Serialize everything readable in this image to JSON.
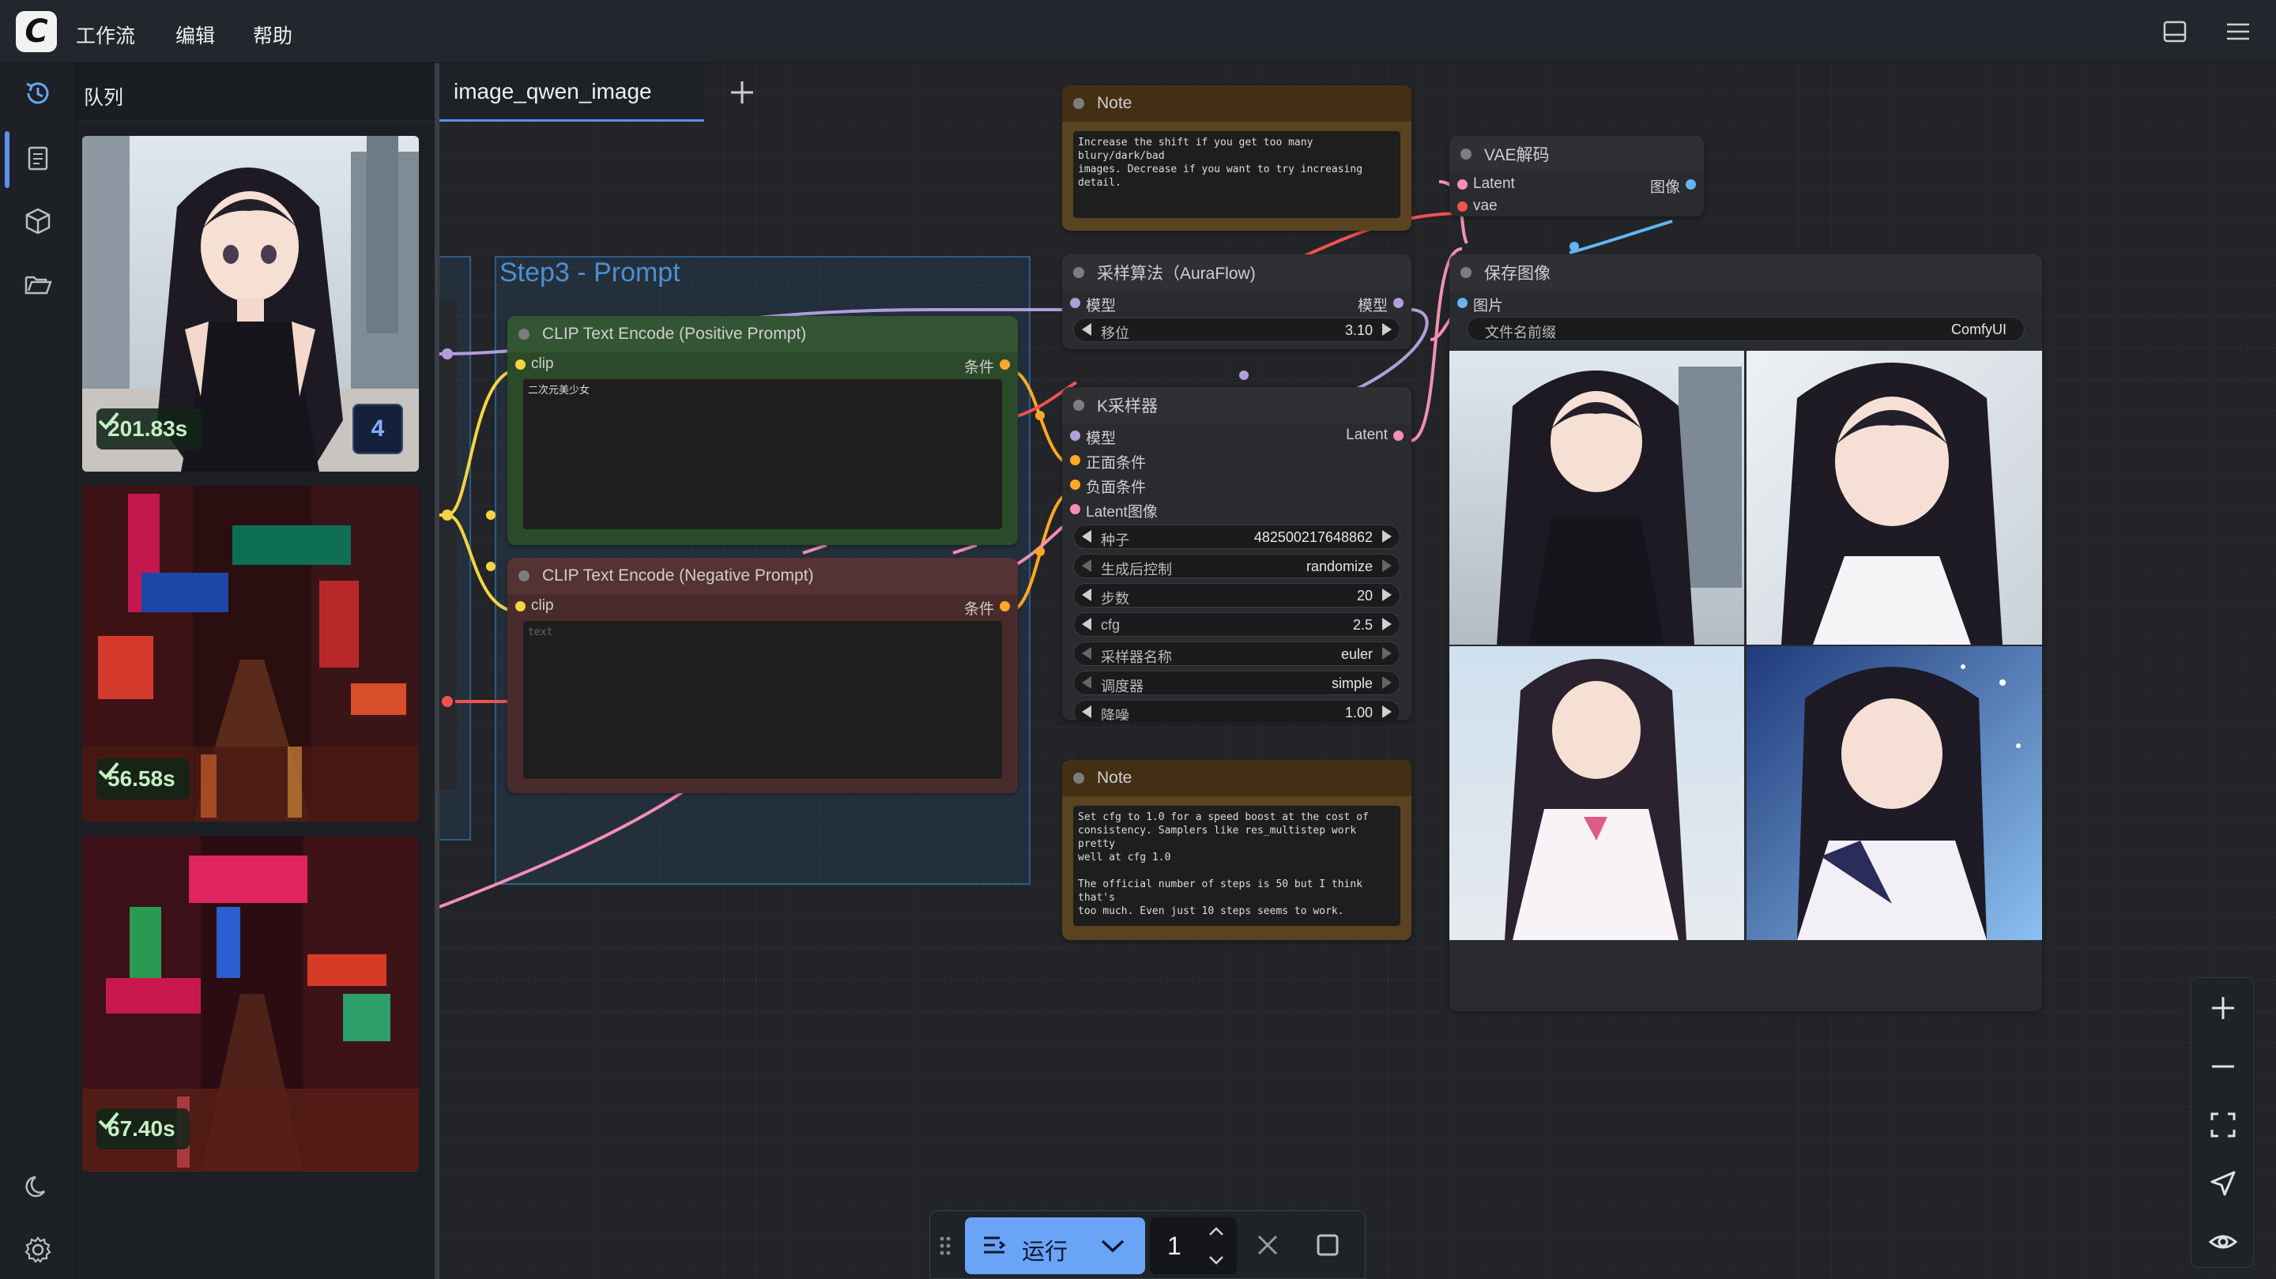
{
  "menu": {
    "items": [
      "工作流",
      "编辑",
      "帮助"
    ]
  },
  "queue": {
    "title": "队列",
    "items": [
      {
        "time": "201.83s",
        "count": "4"
      },
      {
        "time": "56.58s"
      },
      {
        "time": "67.40s"
      }
    ]
  },
  "tabs": {
    "active": "image_qwen_image"
  },
  "group": {
    "title": "Step3 - Prompt"
  },
  "nodes": {
    "note_top": {
      "title": "Note",
      "text": "Increase the shift if you get too many blury/dark/bad\nimages. Decrease if you want to try increasing\ndetail."
    },
    "vae_decode": {
      "title": "VAE解码",
      "in_latent": "Latent",
      "in_vae": "vae",
      "out_image": "图像"
    },
    "aura": {
      "title": "采样算法（AuraFlow)",
      "in_model": "模型",
      "out_model": "模型",
      "shift_label": "移位",
      "shift_value": "3.10"
    },
    "save_image": {
      "title": "保存图像",
      "in_images": "图片",
      "prefix_label": "文件名前缀",
      "prefix_value": "ComfyUI"
    },
    "clip_pos": {
      "title": "CLIP Text Encode (Positive Prompt)",
      "in_clip": "clip",
      "out_cond": "条件",
      "text": "二次元美少女"
    },
    "clip_neg": {
      "title": "CLIP Text Encode (Negative Prompt)",
      "in_clip": "clip",
      "out_cond": "条件",
      "placeholder": "text"
    },
    "ksampler": {
      "title": "K采样器",
      "inputs": [
        "模型",
        "正面条件",
        "负面条件",
        "Latent图像"
      ],
      "out_latent": "Latent",
      "widgets": [
        {
          "label": "种子",
          "value": "482500217648862"
        },
        {
          "label": "生成后控制",
          "value": "randomize"
        },
        {
          "label": "步数",
          "value": "20"
        },
        {
          "label": "cfg",
          "value": "2.5"
        },
        {
          "label": "采样器名称",
          "value": "euler"
        },
        {
          "label": "调度器",
          "value": "simple"
        },
        {
          "label": "降噪",
          "value": "1.00"
        }
      ]
    },
    "note_bottom": {
      "title": "Note",
      "text": "Set cfg to 1.0 for a speed boost at the cost of\nconsistency. Samplers like res_multistep work pretty\nwell at cfg 1.0\n\nThe official number of steps is 50 but I think that's\ntoo much. Even just 10 steps seems to work."
    }
  },
  "runbar": {
    "run_label": "运行",
    "count": "1"
  },
  "colors": {
    "accent": "#6aa4f7",
    "clip_pos_head": "#335533",
    "clip_neg_head": "#553333",
    "note_head": "#432f14",
    "wire_clip": "#f5d442",
    "wire_model": "#b39ddb",
    "wire_latent": "#f48fb1",
    "wire_cond": "#ffa726",
    "wire_vae": "#ef5350",
    "wire_image": "#64b5f6"
  }
}
